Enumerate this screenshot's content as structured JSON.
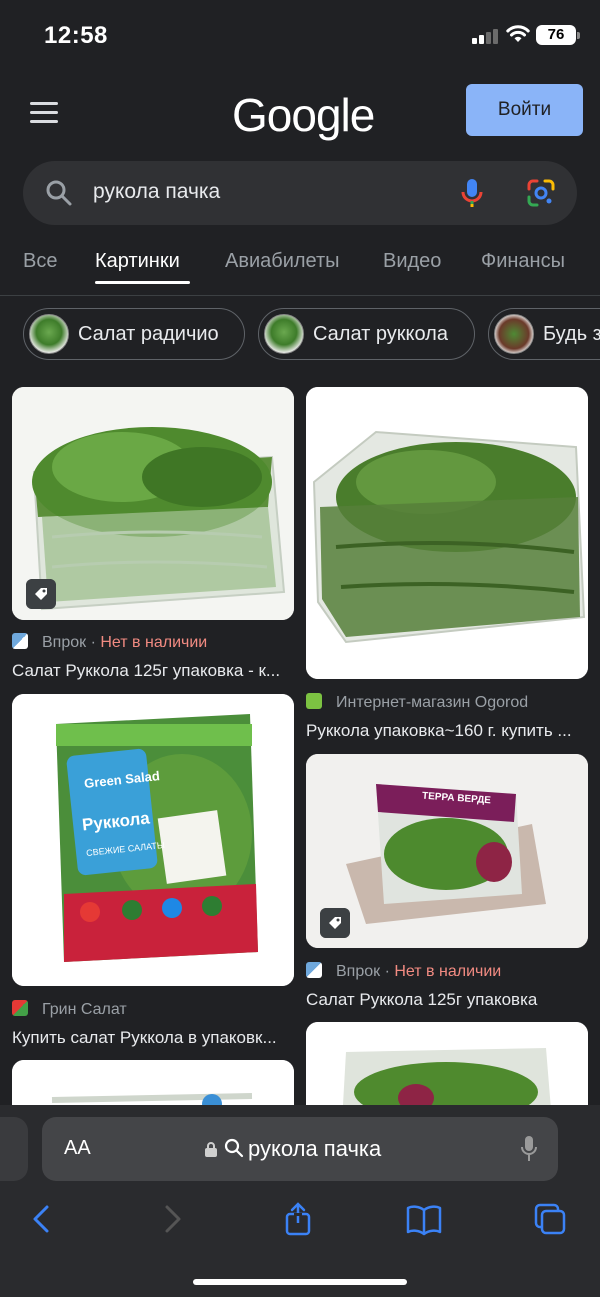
{
  "status_bar": {
    "time": "12:58",
    "battery": "76"
  },
  "header": {
    "logo": "Google",
    "signin_label": "Войти",
    "menu_icon": "hamburger-menu-icon"
  },
  "search": {
    "query": "рукола пачка",
    "icons": [
      "search-icon",
      "mic-icon",
      "google-lens-icon"
    ]
  },
  "tabs": [
    {
      "label": "Все",
      "active": false
    },
    {
      "label": "Картинки",
      "active": true
    },
    {
      "label": "Авиабилеты",
      "active": false
    },
    {
      "label": "Видео",
      "active": false
    },
    {
      "label": "Финансы",
      "active": false
    }
  ],
  "chips": [
    {
      "label": "Салат радичио"
    },
    {
      "label": "Салат руккола"
    },
    {
      "label": "Будь з"
    }
  ],
  "results": [
    {
      "source": "Впрок",
      "stock": "Нет в наличии",
      "title": "Салат Руккола 125г упаковка - к...",
      "has_tag": true
    },
    {
      "source": "Интернет-магазин Ogorod",
      "stock": "",
      "title": "Руккола упаковка~160 г. купить ...",
      "has_tag": false
    },
    {
      "source": "Грин Салат",
      "stock": "",
      "title": "Купить салат Руккола в упаковк...",
      "has_tag": false,
      "package_texts": [
        "Green Salad",
        "Руккола",
        "СВЕЖИЕ САЛАТЫ"
      ]
    },
    {
      "source": "Впрок",
      "stock": "Нет в наличии",
      "title": "Салат Руккола 125г упаковка",
      "has_tag": true,
      "package_texts": [
        "ТЕРРА ВЕРДЕ"
      ]
    }
  ],
  "colors": {
    "background": "#202124",
    "signin_button": "#8ab4f8",
    "out_of_stock": "#f28b82",
    "muted_text": "#9aa0a6"
  },
  "browser_bar": {
    "aa_label": "AA",
    "address": "рукола пачка",
    "icons": [
      "back-icon",
      "forward-icon",
      "share-icon",
      "bookmarks-icon",
      "tabs-icon"
    ]
  }
}
